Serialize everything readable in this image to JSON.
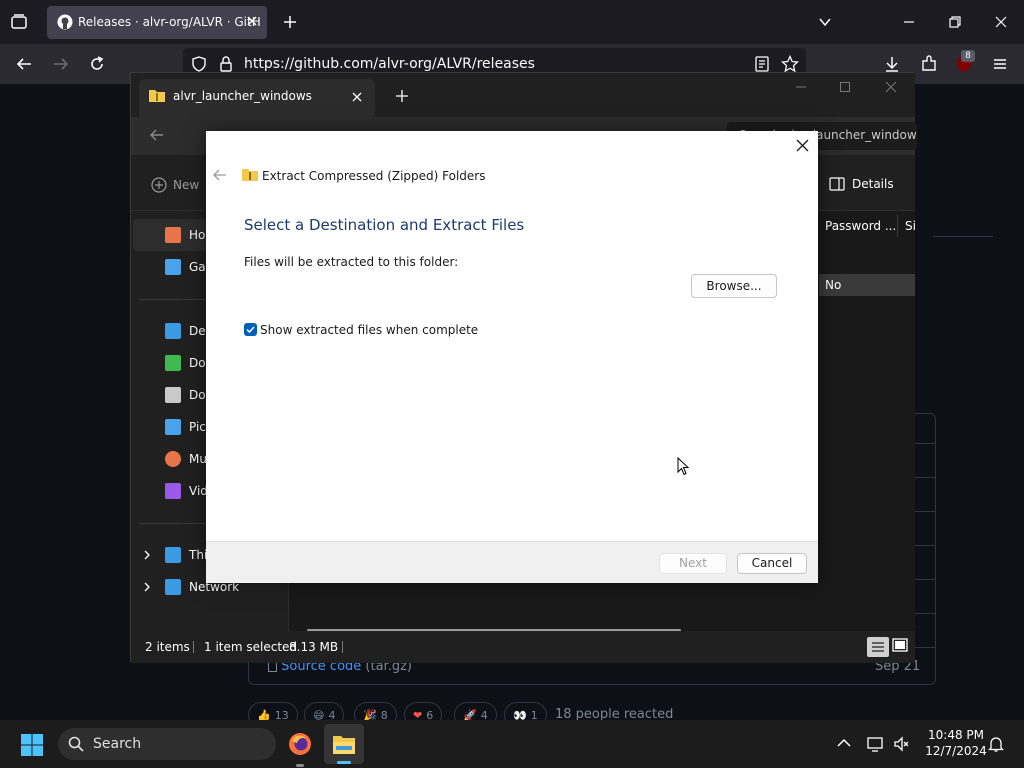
{
  "browser": {
    "tab_title": "Releases · alvr-org/ALVR · GitH",
    "url": "https://github.com/alvr-org/ALVR/releases",
    "extension_badge": "8"
  },
  "github": {
    "asset_label": "Source code",
    "asset_suffix": "(tar.gz)",
    "asset_date": "Sep 21",
    "reactions": [
      {
        "emoji": "👍",
        "count": "13"
      },
      {
        "emoji": "😄",
        "count": "4"
      },
      {
        "emoji": "🎉",
        "count": "8"
      },
      {
        "emoji": "❤",
        "count": "6"
      },
      {
        "emoji": "🚀",
        "count": "4"
      },
      {
        "emoji": "👀",
        "count": "1"
      }
    ],
    "reaction_summary": "18 people reacted"
  },
  "explorer": {
    "tab_title": "alvr_launcher_windows",
    "search_placeholder": "Search alvr_launcher_windows",
    "new_label": "New",
    "details_label": "Details",
    "columns": {
      "password": "Password ...",
      "size": "Si"
    },
    "row_password_value": "No",
    "sidebar": [
      {
        "label": "Home",
        "icon": "home-icon",
        "color": "#e8744a"
      },
      {
        "label": "Gallery",
        "icon": "gallery-icon",
        "color": "#4aa3e8"
      },
      {
        "label": "Desktop",
        "icon": "desktop-icon",
        "color": "#3b9ae1"
      },
      {
        "label": "Downloads",
        "icon": "downloads-icon",
        "color": "#3fb950"
      },
      {
        "label": "Documents",
        "icon": "documents-icon",
        "color": "#c9c9c9"
      },
      {
        "label": "Pictures",
        "icon": "pictures-icon",
        "color": "#4aa3e8"
      },
      {
        "label": "Music",
        "icon": "music-icon",
        "color": "#e8744a"
      },
      {
        "label": "Videos",
        "icon": "videos-icon",
        "color": "#9b59e8"
      },
      {
        "label": "This PC",
        "icon": "this-pc-icon",
        "color": "#3b9ae1"
      },
      {
        "label": "Network",
        "icon": "network-icon",
        "color": "#3b9ae1"
      }
    ],
    "status": {
      "items": "2 items",
      "selected": "1 item selected",
      "size": "8.13 MB"
    }
  },
  "dialog": {
    "title": "Extract Compressed (Zipped) Folders",
    "heading": "Select a Destination and Extract Files",
    "folder_label": "Files will be extracted to this folder:",
    "browse_label": "Browse...",
    "checkbox_label": "Show extracted files when complete",
    "checkbox_checked": true,
    "next_label": "Next",
    "cancel_label": "Cancel",
    "accent": "#005fb8"
  },
  "taskbar": {
    "search_label": "Search",
    "time": "10:48 PM",
    "date": "12/7/2024"
  }
}
